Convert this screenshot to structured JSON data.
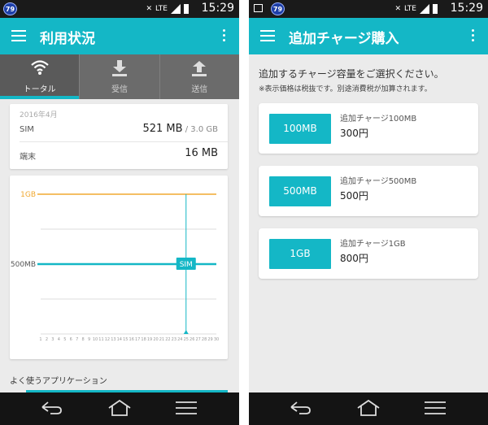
{
  "status": {
    "badge": "79",
    "clock": "15:29",
    "lte": "LTE"
  },
  "colors": {
    "accent": "#14b7c6",
    "limit_line": "#f0a830",
    "appbar": "#14b7c6"
  },
  "left": {
    "title": "利用状況",
    "tabs": [
      {
        "label": "トータル",
        "icon": "wifi-icon",
        "active": true
      },
      {
        "label": "受信",
        "icon": "download-icon",
        "active": false
      },
      {
        "label": "送信",
        "icon": "upload-icon",
        "active": false
      }
    ],
    "usage": {
      "period": "2016年4月",
      "sim_label": "SIM",
      "sim_value": "521 MB",
      "sim_total": " / 3.0 GB",
      "device_label": "端末",
      "device_value": "16 MB"
    },
    "section_title": "よく使うアプリケーション"
  },
  "chart_data": {
    "type": "line",
    "x": [
      1,
      2,
      3,
      4,
      5,
      6,
      7,
      8,
      9,
      10,
      11,
      12,
      13,
      14,
      15,
      16,
      17,
      18,
      19,
      20,
      21,
      22,
      23,
      24,
      25,
      26,
      27,
      28,
      29,
      30
    ],
    "y_ticks": [
      "1GB",
      "500MB"
    ],
    "reference_lines": [
      {
        "label": "1GB",
        "value": 1000,
        "color": "#f0a830"
      },
      {
        "label": "500MB",
        "value": 500,
        "color": "#14b7c6"
      }
    ],
    "current_day": 25,
    "marker": {
      "label": "SIM",
      "x": 25,
      "y": 500
    },
    "ylim": [
      0,
      1000
    ]
  },
  "right": {
    "title": "追加チャージ購入",
    "prompt": "追加するチャージ容量をご選択ください。",
    "note": "※表示価格は税抜です。別途消費税が加算されます。",
    "options": [
      {
        "button": "100MB",
        "name": "追加チャージ100MB",
        "price": "300円"
      },
      {
        "button": "500MB",
        "name": "追加チャージ500MB",
        "price": "500円"
      },
      {
        "button": "1GB",
        "name": "追加チャージ1GB",
        "price": "800円"
      }
    ]
  }
}
